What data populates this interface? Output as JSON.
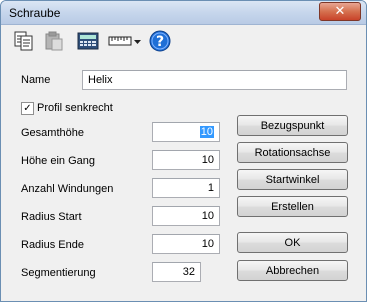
{
  "window": {
    "title": "Schraube",
    "close_glyph": "✕"
  },
  "toolbar": {
    "icons": [
      "copy-icon",
      "paste-icon",
      "calculator-icon",
      "ruler-icon",
      "dropdown-arrow-icon",
      "help-icon"
    ]
  },
  "form": {
    "name_label": "Name",
    "name_value": "Helix",
    "profile_checkbox_label": "Profil senkrecht",
    "profile_checked": true,
    "fields": [
      {
        "label": "Gesamthöhe",
        "value": "10"
      },
      {
        "label": "Höhe ein Gang",
        "value": "10"
      },
      {
        "label": "Anzahl Windungen",
        "value": "1"
      },
      {
        "label": "Radius Start",
        "value": "10"
      },
      {
        "label": "Radius Ende",
        "value": "10"
      },
      {
        "label": "Segmentierung",
        "value": "32"
      }
    ]
  },
  "buttons": {
    "reference_point": "Bezugspunkt",
    "rotation_axis": "Rotationsachse",
    "start_angle": "Startwinkel",
    "create": "Erstellen",
    "ok": "OK",
    "cancel": "Abbrechen"
  },
  "colors": {
    "selection": "#3399ff",
    "help_blue": "#1f6fd6",
    "close_red": "#c9432a"
  }
}
